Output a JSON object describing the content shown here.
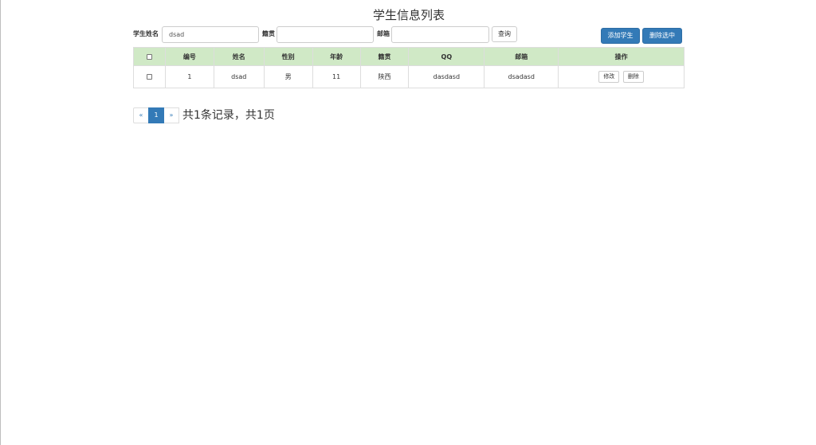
{
  "page_title": "学生信息列表",
  "search": {
    "name_label": "学生姓名",
    "name_value": "dsad",
    "hometown_label": "籍贯",
    "hometown_value": "",
    "email_label": "邮箱",
    "email_value": "",
    "query_button": "查询"
  },
  "actions": {
    "add_button": "添加学生",
    "delete_selected_button": "删除选中"
  },
  "table": {
    "columns": [
      "编号",
      "姓名",
      "性别",
      "年龄",
      "籍贯",
      "QQ",
      "邮箱",
      "操作"
    ],
    "rows": [
      {
        "id": "1",
        "name": "dsad",
        "gender": "男",
        "age": "11",
        "hometown": "陕西",
        "qq": "dasdasd",
        "email": "dsadasd",
        "edit_label": "修改",
        "delete_label": "删除"
      }
    ]
  },
  "pagination": {
    "prev": "«",
    "current": "1",
    "next": "»",
    "summary": "共1条记录，共1页"
  },
  "colors": {
    "primary": "#337ab7",
    "header_bg": "#d0e9c6"
  }
}
